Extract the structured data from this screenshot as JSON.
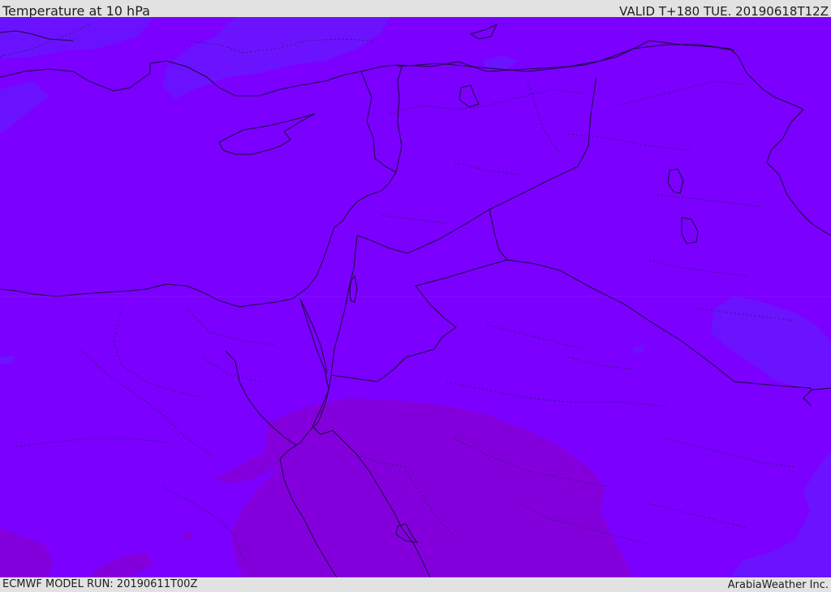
{
  "header": {
    "title": "Temperature at 10 hPa",
    "valid": "VALID T+180 TUE. 20190618T12Z"
  },
  "footer": {
    "model_run": "ECMWF MODEL RUN: 20190611T00Z",
    "credit": "ArabiaWeather Inc."
  },
  "map": {
    "field": "Temperature at 10 hPa",
    "colors": {
      "base": "#7b00ff",
      "cooler": "#6a14ff",
      "warmer": "#8300dd",
      "coastline": "#1a0a3a",
      "borders": "#2a1a55"
    }
  }
}
